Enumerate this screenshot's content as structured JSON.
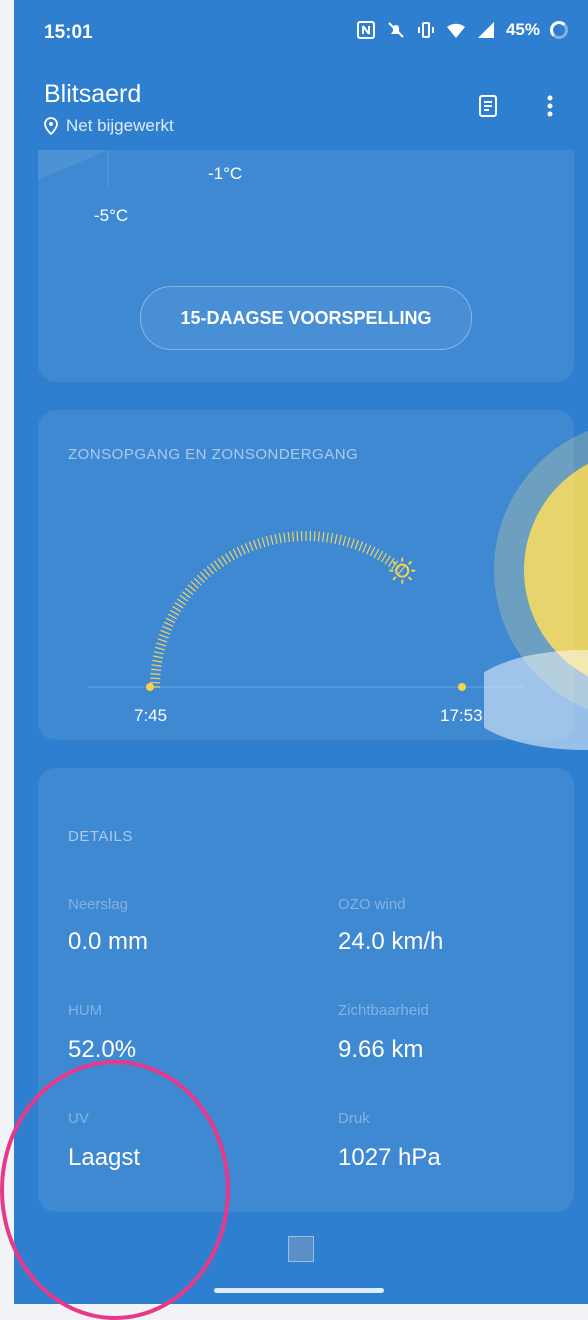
{
  "status_bar": {
    "time": "15:01",
    "battery": "45%",
    "icons": [
      "nfc-icon",
      "mute-icon",
      "vibrate-icon",
      "wifi-icon",
      "signal-icon",
      "battery-icon"
    ]
  },
  "header": {
    "city": "Blitsaerd",
    "updated": "Net bijgewerkt",
    "icons": [
      "location-pin-icon",
      "news-icon",
      "more-vert-icon"
    ]
  },
  "forecast": {
    "temp_high": "-1°C",
    "temp_low": "-5°C",
    "button_label": "15-DAAGSE VOORSPELLING"
  },
  "sun": {
    "title": "ZONSOPGANG EN ZONSONDERGANG",
    "sunrise": "7:45",
    "sunset": "17:53",
    "day_progress": 0.72
  },
  "details": {
    "title": "DETAILS",
    "items": [
      {
        "label": "Neerslag",
        "value": "0.0 mm"
      },
      {
        "label": "OZO wind",
        "value": "24.0 km/h"
      },
      {
        "label": "HUM",
        "value": "52.0%"
      },
      {
        "label": "Zichtbaarheid",
        "value": "9.66 km"
      },
      {
        "label": "UV",
        "value": "Laagst"
      },
      {
        "label": "Druk",
        "value": "1027 hPa"
      }
    ]
  },
  "colors": {
    "background": "#2f7fd0",
    "accent_sun": "#f5d24a",
    "highlight": "#e8388a"
  }
}
